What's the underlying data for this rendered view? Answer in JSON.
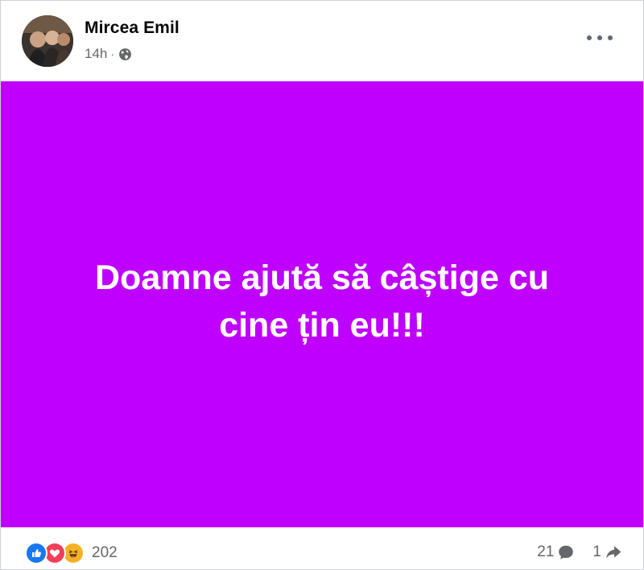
{
  "post": {
    "author": "Mircea Emil",
    "time": "14h",
    "separator": "·",
    "privacy_icon": "globe-icon",
    "menu_icon": "more-horizontal-icon",
    "text": "Doamne ajută să câștige cu cine țin eu!!!",
    "background_color": "#bf00ff"
  },
  "footer": {
    "reactions": [
      "like-reaction-icon",
      "love-reaction-icon",
      "haha-reaction-icon"
    ],
    "reaction_count": "202",
    "comment_count": "21",
    "comment_icon": "comment-icon",
    "share_count": "1",
    "share_icon": "share-icon"
  },
  "colors": {
    "like": "#1877f2",
    "love": "#f33e58",
    "haha": "#f7b125",
    "meta_text": "#65676b"
  }
}
